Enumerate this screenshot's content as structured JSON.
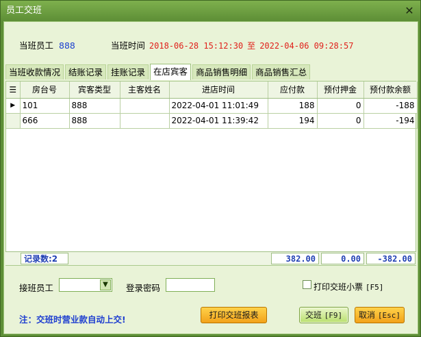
{
  "window": {
    "title": "员工交班",
    "close_glyph": "✕"
  },
  "info": {
    "current_staff_label": "当班员工",
    "current_staff_value": "888",
    "shift_time_label": "当班时间",
    "shift_start": "2018-06-28 15:12:30",
    "to_label": "至",
    "shift_end": "2022-04-06 09:28:57"
  },
  "tabs": [
    {
      "label": "当班收款情况"
    },
    {
      "label": "结账记录"
    },
    {
      "label": "挂账记录"
    },
    {
      "label": "在店宾客"
    },
    {
      "label": "商品销售明细"
    },
    {
      "label": "商品销售汇总"
    }
  ],
  "active_tab": "在店宾客",
  "grid": {
    "columns": [
      "房台号",
      "宾客类型",
      "主客姓名",
      "进店时间",
      "应付款",
      "预付押金",
      "预付款余额"
    ],
    "rows": [
      {
        "indicator": "▶",
        "room": "101",
        "guest_type": "888",
        "guest_name": "",
        "checkin": "2022-04-01 11:01:49",
        "payable": "188",
        "deposit": "0",
        "balance": "-188"
      },
      {
        "indicator": "",
        "room": "666",
        "guest_type": "888",
        "guest_name": "",
        "checkin": "2022-04-01 11:39:42",
        "payable": "194",
        "deposit": "0",
        "balance": "-194"
      }
    ],
    "totals": {
      "count_label": "记录数:2",
      "payable": "382.00",
      "deposit": "0.00",
      "balance": "-382.00"
    }
  },
  "form": {
    "receiver_label": "接班员工",
    "receiver_value": "",
    "password_label": "登录密码",
    "password_value": "",
    "print_ticket_label": "打印交班小票",
    "print_ticket_key": "[F5]"
  },
  "note": "注：交班时营业款自动上交!",
  "buttons": {
    "print_report": "打印交班报表",
    "handover": "交班",
    "handover_key": "[F9]",
    "cancel": "取消",
    "cancel_key": "[Esc]"
  },
  "colors": {
    "frame": "#5d8e36",
    "client_bg": "#e9f3d7",
    "accent_blue": "#1a3fd0",
    "accent_red": "#e0201a",
    "button_orange": "#f2a21a"
  }
}
